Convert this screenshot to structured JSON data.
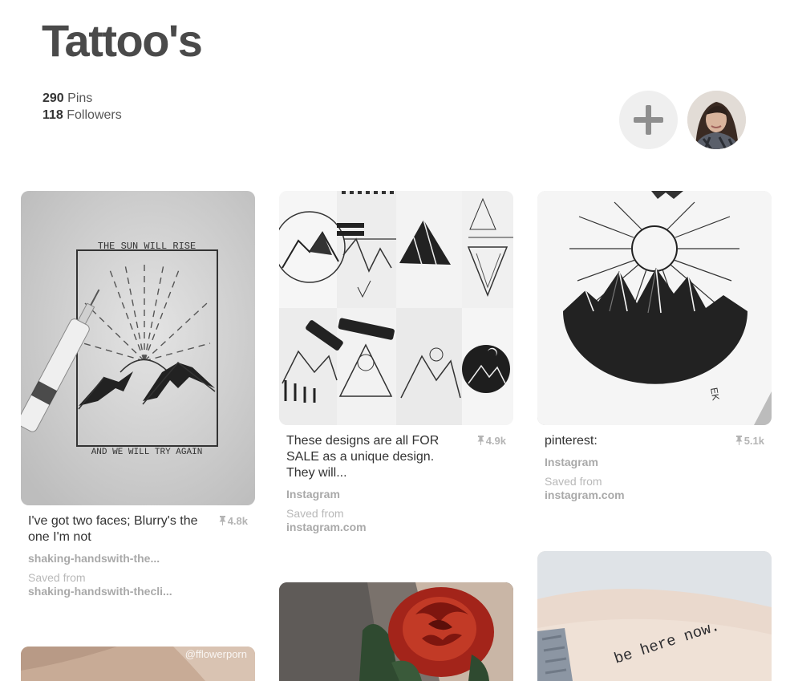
{
  "board": {
    "title": "Tattoo's",
    "pins_count": "290",
    "pins_label": " Pins",
    "followers_count": "118",
    "followers_label": " Followers"
  },
  "pins": [
    {
      "description": "I've got two faces; Blurry's the one I'm not",
      "repins": "4.8k",
      "source": "shaking-handswith-the...",
      "saved_from": "Saved from",
      "saved_domain": "shaking-handswith-thecli...",
      "image_text_top": "THE  SUN  WILL  RISE",
      "image_text_bottom": "AND  WE  WILL  TRY  AGAIN"
    },
    {
      "description": "These designs are all FOR SALE as a unique design. They will...",
      "repins": "4.9k",
      "source": "Instagram",
      "saved_from": "Saved from",
      "saved_domain": "instagram.com"
    },
    {
      "description": "pinterest:",
      "repins": "5.1k",
      "source": "Instagram",
      "saved_from": "Saved from",
      "saved_domain": "instagram.com"
    },
    {
      "image_watermark": "@fflowerporn"
    },
    {
      "image_subject": "red rose tattoo"
    },
    {
      "image_text": "be here now."
    }
  ]
}
